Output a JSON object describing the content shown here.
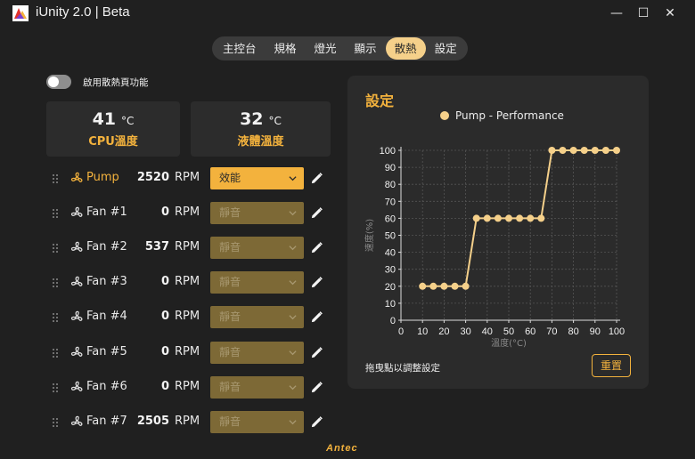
{
  "window": {
    "title": "iUnity 2.0 | Beta",
    "min_glyph": "—",
    "max_glyph": "☐",
    "close_glyph": "✕"
  },
  "tabs": [
    {
      "label": "主控台",
      "active": false
    },
    {
      "label": "規格",
      "active": false
    },
    {
      "label": "燈光",
      "active": false
    },
    {
      "label": "顯示",
      "active": false
    },
    {
      "label": "散熱",
      "active": true
    },
    {
      "label": "設定",
      "active": false
    }
  ],
  "cooling": {
    "enable_label": "啟用散熱頁功能",
    "enabled": false,
    "cpu": {
      "value": "41",
      "unit": "°C",
      "label": "CPU溫度"
    },
    "liquid": {
      "value": "32",
      "unit": "°C",
      "label": "液體溫度"
    },
    "fans": [
      {
        "name": "Pump",
        "rpm": "2520",
        "unit": "RPM",
        "mode": "效能",
        "active": true
      },
      {
        "name": "Fan #1",
        "rpm": "0",
        "unit": "RPM",
        "mode": "靜音",
        "active": false
      },
      {
        "name": "Fan #2",
        "rpm": "537",
        "unit": "RPM",
        "mode": "靜音",
        "active": false
      },
      {
        "name": "Fan #3",
        "rpm": "0",
        "unit": "RPM",
        "mode": "靜音",
        "active": false
      },
      {
        "name": "Fan #4",
        "rpm": "0",
        "unit": "RPM",
        "mode": "靜音",
        "active": false
      },
      {
        "name": "Fan #5",
        "rpm": "0",
        "unit": "RPM",
        "mode": "靜音",
        "active": false
      },
      {
        "name": "Fan #6",
        "rpm": "0",
        "unit": "RPM",
        "mode": "靜音",
        "active": false
      },
      {
        "name": "Fan #7",
        "rpm": "2505",
        "unit": "RPM",
        "mode": "靜音",
        "active": false
      }
    ]
  },
  "settings": {
    "title": "設定",
    "legend": "Pump - Performance",
    "hint": "拖曳點以調整設定",
    "reset_label": "重置"
  },
  "brand": "Antec",
  "colors": {
    "accent": "#f3b23d",
    "accent_light": "#f5d08a",
    "panel": "#2b2b2b",
    "background": "#202020"
  },
  "chart_data": {
    "type": "line",
    "series": [
      {
        "name": "Pump - Performance",
        "x": [
          10,
          15,
          20,
          25,
          30,
          35,
          40,
          45,
          50,
          55,
          60,
          65,
          70,
          75,
          80,
          85,
          90,
          95,
          100
        ],
        "y": [
          20,
          20,
          20,
          20,
          20,
          60,
          60,
          60,
          60,
          60,
          60,
          60,
          100,
          100,
          100,
          100,
          100,
          100,
          100
        ]
      }
    ],
    "xlabel": "溫度(°C)",
    "ylabel": "速度(%)",
    "xlim": [
      0,
      100
    ],
    "ylim": [
      0,
      100
    ],
    "xticks": [
      0,
      10,
      20,
      30,
      40,
      50,
      60,
      70,
      80,
      90,
      100
    ],
    "yticks": [
      0,
      10,
      20,
      30,
      40,
      50,
      60,
      70,
      80,
      90,
      100
    ],
    "grid": true,
    "legend_position": "top"
  }
}
